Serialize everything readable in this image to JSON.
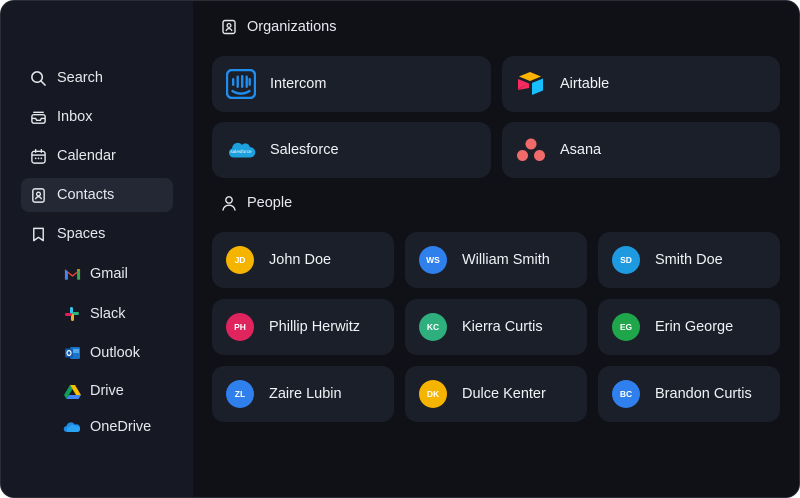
{
  "sidebar": {
    "items": [
      {
        "label": "Search",
        "icon": "search-icon"
      },
      {
        "label": "Inbox",
        "icon": "inbox-icon"
      },
      {
        "label": "Calendar",
        "icon": "calendar-icon"
      },
      {
        "label": "Contacts",
        "icon": "contacts-icon",
        "active": true
      },
      {
        "label": "Spaces",
        "icon": "bookmark-icon"
      }
    ],
    "spaces": [
      {
        "label": "Gmail",
        "icon": "gmail-icon"
      },
      {
        "label": "Slack",
        "icon": "slack-icon"
      },
      {
        "label": "Outlook",
        "icon": "outlook-icon"
      },
      {
        "label": "Drive",
        "icon": "drive-icon"
      },
      {
        "label": "OneDrive",
        "icon": "onedrive-icon"
      }
    ]
  },
  "organizations": {
    "title": "Organizations",
    "items": [
      {
        "name": "Intercom",
        "icon": "intercom-logo"
      },
      {
        "name": "Airtable",
        "icon": "airtable-logo"
      },
      {
        "name": "Salesforce",
        "icon": "salesforce-logo",
        "logo_text": "salesforce"
      },
      {
        "name": "Asana",
        "icon": "asana-logo"
      }
    ]
  },
  "people": {
    "title": "People",
    "items": [
      {
        "name": "John Doe",
        "initials": "JD",
        "color": "#f5b400"
      },
      {
        "name": "William Smith",
        "initials": "WS",
        "color": "#2f80ed"
      },
      {
        "name": "Smith Doe",
        "initials": "SD",
        "color": "#1e9be0"
      },
      {
        "name": "Phillip Herwitz",
        "initials": "PH",
        "color": "#e0245e"
      },
      {
        "name": "Kierra Curtis",
        "initials": "KC",
        "color": "#2eaf7d"
      },
      {
        "name": "Erin George",
        "initials": "EG",
        "color": "#1fa64a"
      },
      {
        "name": "Zaire Lubin",
        "initials": "ZL",
        "color": "#2f80ed"
      },
      {
        "name": "Dulce Kenter",
        "initials": "DK",
        "color": "#f5b400"
      },
      {
        "name": "Brandon Curtis",
        "initials": "BC",
        "color": "#2f80ed"
      }
    ]
  },
  "colors": {
    "background": "#0f1117",
    "sidebar": "#161923",
    "card": "#1b1f2a",
    "active_item": "#242834",
    "text": "#f0f2f6"
  }
}
